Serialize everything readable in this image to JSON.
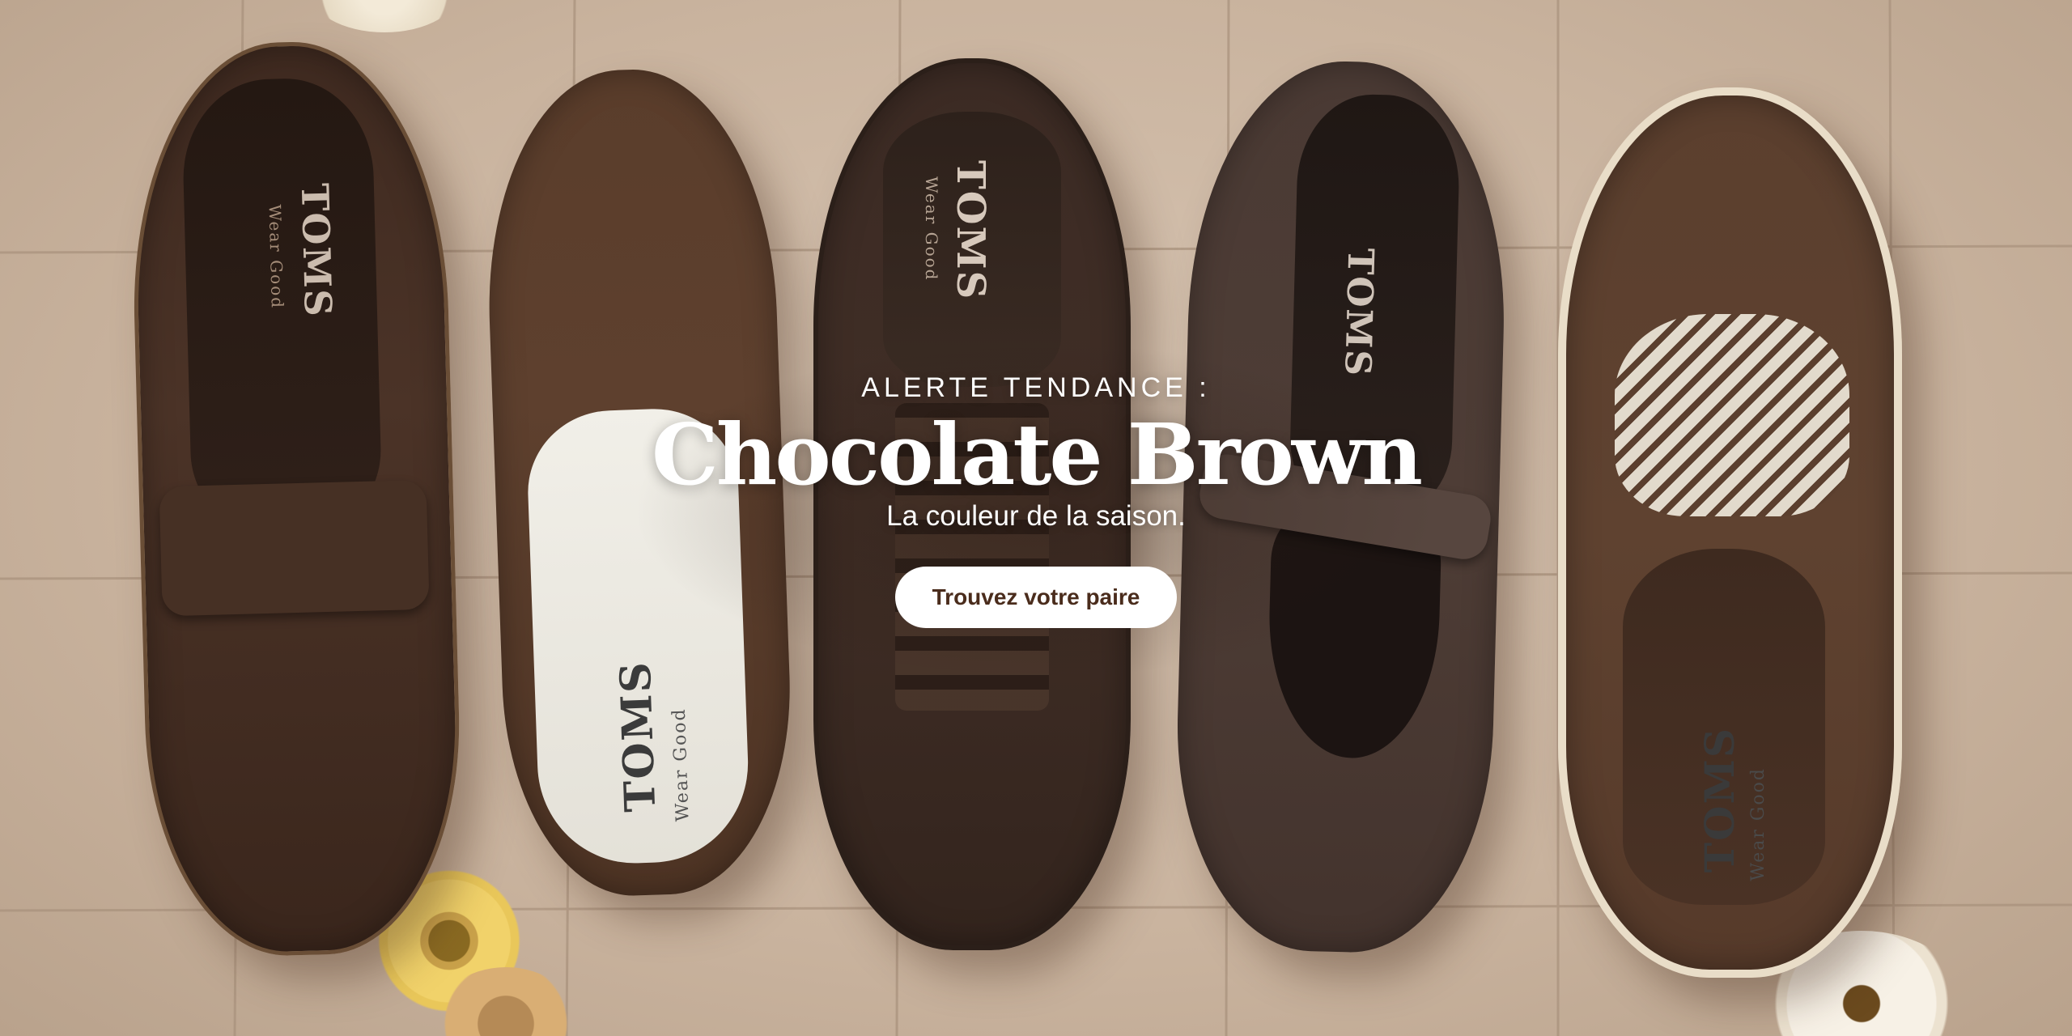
{
  "hero": {
    "eyebrow": "ALERTE TENDANCE :",
    "headline": "Chocolate Brown",
    "subline": "La couleur de la saison.",
    "cta_label": "Trouvez votre paire"
  },
  "shoes": [
    {
      "name": "suede-loafer",
      "brand": "TOMS",
      "tagline": "Wear Good"
    },
    {
      "name": "slip-on-alpargata",
      "brand": "TOMS",
      "tagline": "Wear Good"
    },
    {
      "name": "sneaker",
      "brand": "TOMS",
      "tagline": "Wear Good"
    },
    {
      "name": "mary-jane",
      "brand": "TOMS",
      "tagline": ""
    },
    {
      "name": "lace-up-espadrille",
      "brand": "TOMS",
      "tagline": "Wear Good"
    }
  ],
  "colors": {
    "tile": "#cdb9a6",
    "shoe_dark": "#3e2a20",
    "cta_text": "#4a2c1c",
    "cta_bg": "#ffffff"
  }
}
